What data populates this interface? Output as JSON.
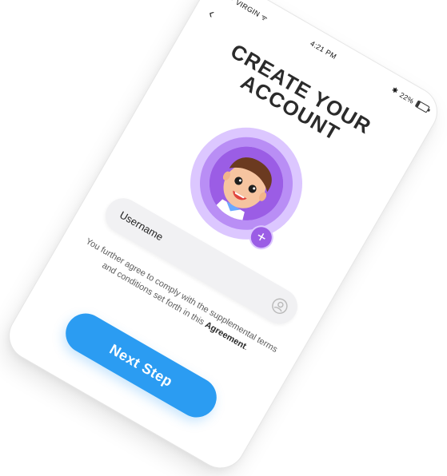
{
  "status_bar": {
    "carrier": "VIRGIN",
    "time": "4:21 PM",
    "battery": "22%"
  },
  "nav": {
    "back_icon": "chevron-left-icon"
  },
  "header": {
    "title_line1": "CREATE YOUR",
    "title_line2": "ACCOUNT"
  },
  "avatar": {
    "name": "avatar",
    "add_icon": "plus-icon",
    "ring_colors": [
      "#dcc7ff",
      "#b98ef5",
      "#9b5de5"
    ]
  },
  "form": {
    "username_label": "Username",
    "username_icon": "user-icon"
  },
  "terms": {
    "text_prefix": "You further agree to comply with the supplemental terms and conditions set forth in this ",
    "bold": "Agreement",
    "suffix": "."
  },
  "actions": {
    "next_label": "Next Step",
    "accent": "#2b9cf2"
  }
}
